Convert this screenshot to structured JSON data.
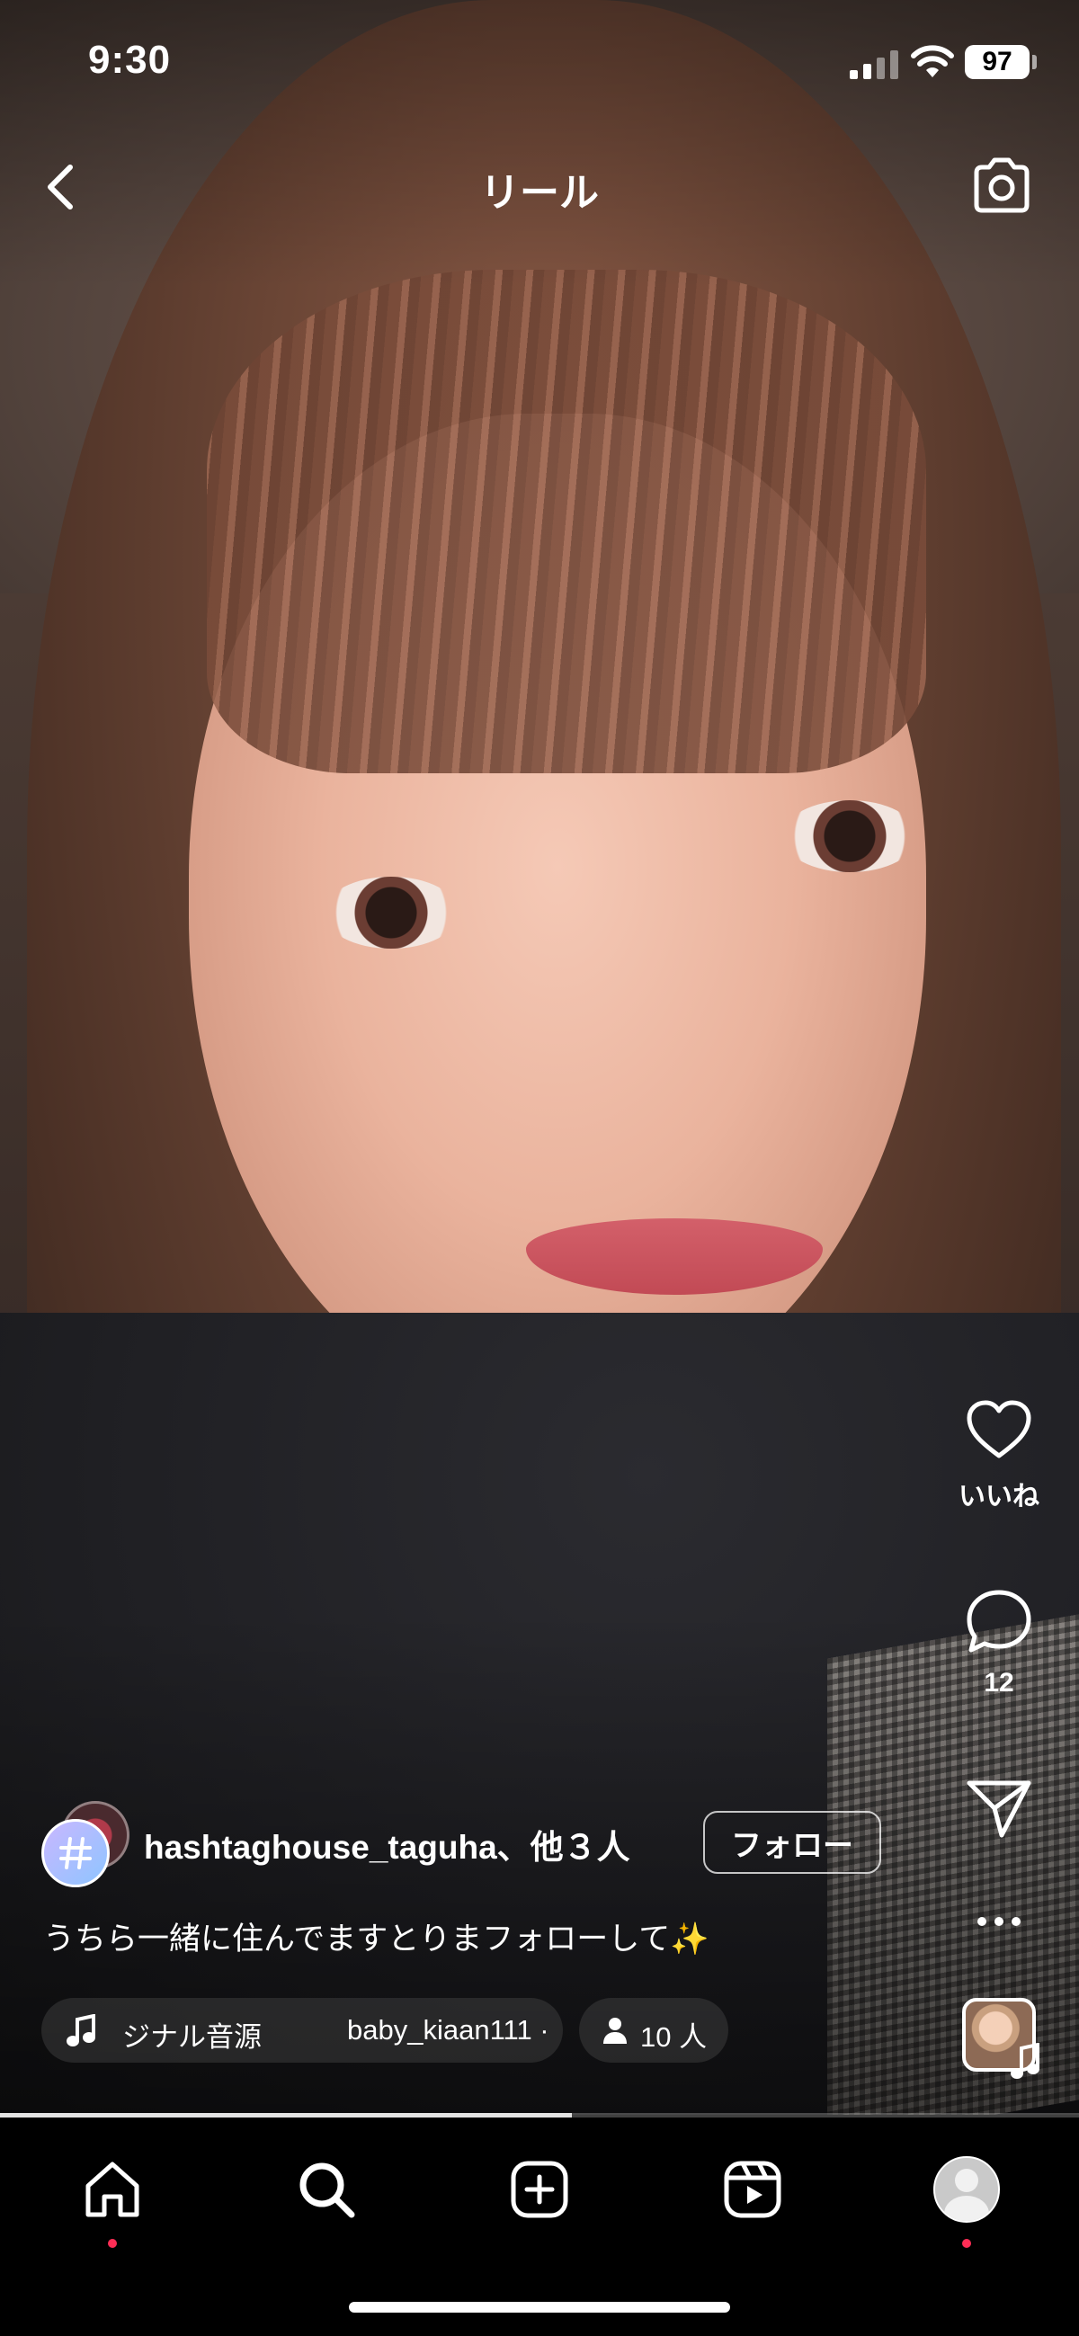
{
  "status_bar": {
    "time": "9:30",
    "battery": "97"
  },
  "header": {
    "title": "リール",
    "back_icon": "chevron-left-icon",
    "camera_icon": "camera-icon"
  },
  "actions": {
    "like_label": "いいね",
    "comment_count": "12"
  },
  "post": {
    "author": "hashtaghouse_taguha、他３人",
    "follow_label": "フォロー",
    "caption": "うちら一緒に住んでますとりまフォローして",
    "caption_emoji": "✨",
    "audio_track": "ジナル音源",
    "audio_sound": "baby_kiaan111 ·",
    "people_count": "10 人"
  },
  "playback": {
    "progress": 0.53
  },
  "nav": {
    "items": [
      "home-icon",
      "search-icon",
      "create-icon",
      "reels-icon",
      "profile-avatar"
    ]
  },
  "colors": {
    "accent_dot": "#ff2d55",
    "background": "#000000"
  }
}
